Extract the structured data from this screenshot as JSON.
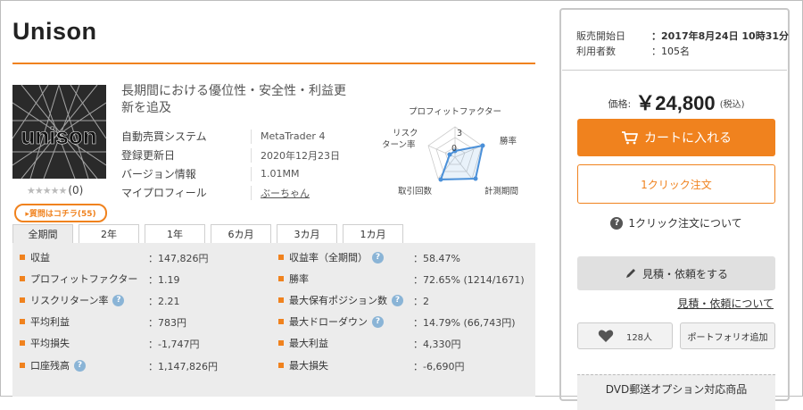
{
  "product": {
    "title": "Unison",
    "thumbnail_text": "unison",
    "stars": "★★★★★",
    "review_count": "(0)",
    "qa_label": "▸質問はコチラ(55)",
    "subtitle": "長期間における優位性・安全性・利益更新を追及",
    "specs": [
      {
        "label": "自動売買システム",
        "value": "MetaTrader 4"
      },
      {
        "label": "登録更新日",
        "value": "2020年12月23日"
      },
      {
        "label": "バージョン情報",
        "value": "1.01MM"
      },
      {
        "label": "マイプロフィール",
        "value": "ぶーちゃん"
      }
    ]
  },
  "radar": {
    "labels": {
      "top": "プロフィットファクター",
      "right_top": "勝率",
      "right_bottom": "計測期間",
      "left_bottom": "取引回数",
      "left_top": "リスク\nターン率",
      "left_top_1": "リスク",
      "left_top_2": "ターン率"
    },
    "scale_label": "3",
    "center_label": "0",
    "color": "#4a90d9"
  },
  "tabs": [
    "全期間",
    "2年",
    "1年",
    "6カ月",
    "3カ月",
    "1カ月"
  ],
  "stats_left": [
    {
      "label": "収益",
      "value": "：147,826円",
      "help": false
    },
    {
      "label": "プロフィットファクター",
      "value": "：1.19",
      "help": false
    },
    {
      "label": "リスクリターン率",
      "value": "：2.21",
      "help": true
    },
    {
      "label": "平均利益",
      "value": "：783円",
      "help": false
    },
    {
      "label": "平均損失",
      "value": "：-1,747円",
      "help": false
    },
    {
      "label": "口座残高",
      "value": "：1,147,826円",
      "help": true
    }
  ],
  "stats_right": [
    {
      "label": "収益率（全期間）",
      "value": "：58.47%",
      "help": true
    },
    {
      "label": "勝率",
      "value": "：72.65% (1214/1671)",
      "help": false
    },
    {
      "label": "最大保有ポジション数",
      "value": "：2",
      "help": true
    },
    {
      "label": "最大ドローダウン",
      "value": "：14.79% (66,743円)",
      "help": true
    },
    {
      "label": "最大利益",
      "value": "：4,330円",
      "help": false
    },
    {
      "label": "最大損失",
      "value": "：-6,690円",
      "help": false
    }
  ],
  "sidebar": {
    "release_label": "販売開始日",
    "release_value": "：2017年8月24日 10時31分",
    "users_label": "利用者数",
    "users_value": "：105名",
    "price_label": "価格:",
    "price_value": "￥24,800",
    "price_tax": "(税込)",
    "cart_label": "カートに入れる",
    "oneclick_label": "1クリック注文",
    "oneclick_about": "1クリック注文について",
    "quote_label": "見積・依頼をする",
    "quote_link": "見積・依頼について",
    "like_count": "128人",
    "portfolio_label": "ポートフォリオ追加",
    "dvd_label": "DVD郵送オプション対応商品"
  },
  "colors": {
    "accent": "#f0821e",
    "help": "#8ab4d6"
  },
  "icons": [
    "cart-icon",
    "question-circle-icon",
    "pencil-icon",
    "heart-icon",
    "help-icon"
  ]
}
